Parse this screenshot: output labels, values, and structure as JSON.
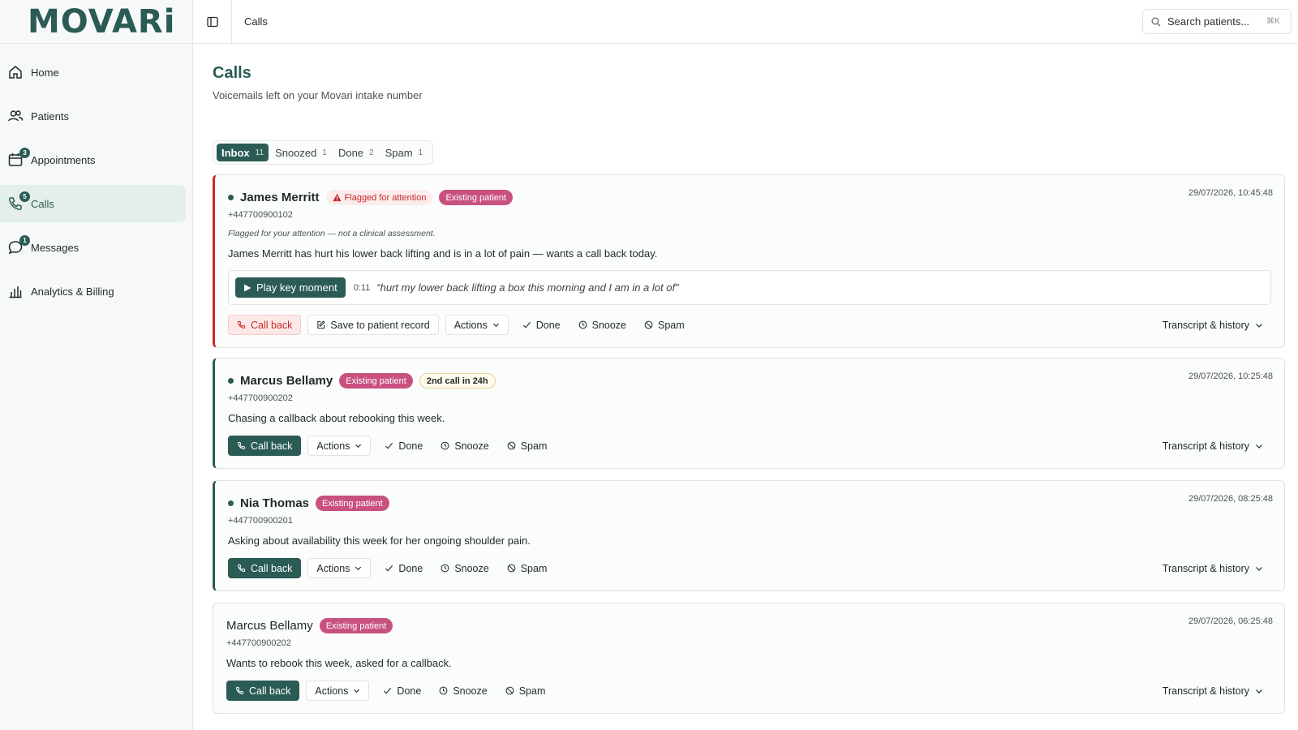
{
  "brand": {
    "logo_text": "MOVARi"
  },
  "sidebar": {
    "items": [
      {
        "label": "Home",
        "icon": "home-icon"
      },
      {
        "label": "Patients",
        "icon": "users-icon"
      },
      {
        "label": "Appointments",
        "icon": "calendar-icon",
        "badge": "3"
      },
      {
        "label": "Calls",
        "icon": "phone-icon",
        "badge": "5"
      },
      {
        "label": "Messages",
        "icon": "chat-icon",
        "badge": "1"
      },
      {
        "label": "Analytics & Billing",
        "icon": "chart-icon"
      }
    ],
    "active": "Calls"
  },
  "topbar": {
    "breadcrumb": "Calls",
    "search_placeholder": "Search patients...",
    "search_shortcut": "⌘K"
  },
  "page": {
    "title": "Calls",
    "subtitle": "Voicemails left on your Movari intake number"
  },
  "tabs": [
    {
      "label": "Inbox",
      "count": "11"
    },
    {
      "label": "Snoozed",
      "count": "1"
    },
    {
      "label": "Done",
      "count": "2"
    },
    {
      "label": "Spam",
      "count": "1"
    }
  ],
  "labels": {
    "call_back": "Call back",
    "save_record": "Save to patient record",
    "actions": "Actions",
    "done": "Done",
    "snooze": "Snooze",
    "spam": "Spam",
    "history": "Transcript & history",
    "play_key_moment": "Play key moment"
  },
  "colors": {
    "brand": "#2b5b55",
    "flag_red": "#c42a2a",
    "existing_badge": "#c8517f"
  },
  "calls": [
    {
      "name": "James Merritt",
      "unread": true,
      "flag_badge": "Flagged for attention",
      "badge": "Existing patient",
      "phone": "+447700900102",
      "note": "Flagged for your attention — not a clinical assessment.",
      "summary": "James Merritt has hurt his lower back lifting and is in a lot of pain — wants a call back today.",
      "timestamp": "29/07/2026, 10:45:48",
      "key_time": "0:11",
      "key_quote": "“hurt my lower back lifting a box this morning and I am in a lot of”"
    },
    {
      "name": "Marcus Bellamy",
      "unread": true,
      "badge": "Existing patient",
      "extra_badge": "2nd call in 24h",
      "phone": "+447700900202",
      "summary": "Chasing a callback about rebooking this week.",
      "timestamp": "29/07/2026, 10:25:48"
    },
    {
      "name": "Nia Thomas",
      "unread": true,
      "badge": "Existing patient",
      "phone": "+447700900201",
      "summary": "Asking about availability this week for her ongoing shoulder pain.",
      "timestamp": "29/07/2026, 08:25:48"
    },
    {
      "name": "Marcus Bellamy",
      "unread": false,
      "badge": "Existing patient",
      "phone": "+447700900202",
      "summary": "Wants to rebook this week, asked for a callback.",
      "timestamp": "29/07/2026, 06:25:48"
    }
  ]
}
